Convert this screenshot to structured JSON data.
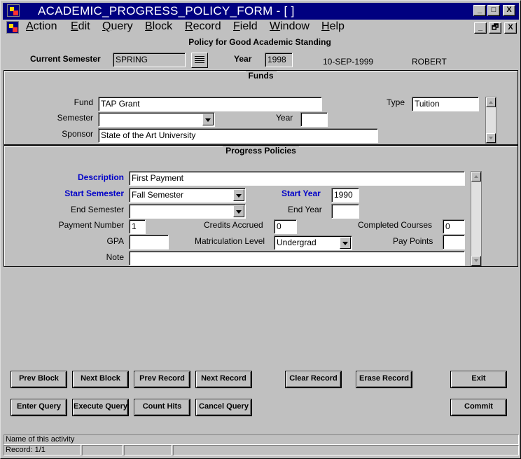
{
  "window": {
    "title": "ACADEMIC_PROGRESS_POLICY_FORM - [ ]",
    "controls": {
      "minimize": "_",
      "maximize": "□",
      "close": "X",
      "restore": "🗗"
    }
  },
  "menu": {
    "items": [
      {
        "label": "Action",
        "accel": "A",
        "rest": "ction"
      },
      {
        "label": "Edit",
        "accel": "E",
        "rest": "dit"
      },
      {
        "label": "Query",
        "accel": "Q",
        "rest": "uery"
      },
      {
        "label": "Block",
        "accel": "B",
        "rest": "lock"
      },
      {
        "label": "Record",
        "accel": "R",
        "rest": "ecord"
      },
      {
        "label": "Field",
        "accel": "F",
        "rest": "ield"
      },
      {
        "label": "Window",
        "accel": "W",
        "rest": "indow"
      },
      {
        "label": "Help",
        "accel": "H",
        "rest": "elp"
      }
    ]
  },
  "header": {
    "form_title": "Policy for Good Academic Standing",
    "current_semester_label": "Current Semester",
    "current_semester_value": "SPRING",
    "year_label": "Year",
    "year_value": "1998",
    "date": "10-SEP-1999",
    "user": "ROBERT"
  },
  "funds": {
    "title": "Funds",
    "fund_label": "Fund",
    "fund_value": "TAP Grant",
    "type_label": "Type",
    "type_value": "Tuition",
    "semester_label": "Semester",
    "semester_value": "",
    "year_label": "Year",
    "year_value": "",
    "sponsor_label": "Sponsor",
    "sponsor_value": "State of the Art University"
  },
  "progress": {
    "title": "Progress Policies",
    "description_label": "Description",
    "description_value": "First Payment",
    "start_semester_label": "Start Semester",
    "start_semester_value": "Fall Semester",
    "start_year_label": "Start Year",
    "start_year_value": "1990",
    "end_semester_label": "End Semester",
    "end_semester_value": "",
    "end_year_label": "End Year",
    "end_year_value": "",
    "payment_number_label": "Payment Number",
    "payment_number_value": "1",
    "credits_accrued_label": "Credits Accrued",
    "credits_accrued_value": "0",
    "completed_courses_label": "Completed Courses",
    "completed_courses_value": "0",
    "gpa_label": "GPA",
    "gpa_value": "",
    "matriculation_label": "Matriculation Level",
    "matriculation_value": "Undergrad",
    "pay_points_label": "Pay Points",
    "pay_points_value": "",
    "note_label": "Note",
    "note_value": ""
  },
  "buttons": {
    "prev_block": "Prev Block",
    "next_block": "Next Block",
    "prev_record": "Prev Record",
    "next_record": "Next Record",
    "clear_record": "Clear Record",
    "erase_record": "Erase Record",
    "exit": "Exit",
    "enter_query": "Enter Query",
    "execute_query": "Execute Query",
    "count_hits": "Count Hits",
    "cancel_query": "Cancel Query",
    "commit": "Commit"
  },
  "status": {
    "message": "Name of this activity",
    "record": "Record: 1/1"
  },
  "icons": {
    "app": "oracle-forms-app-icon",
    "lov": "list-of-values-icon"
  }
}
